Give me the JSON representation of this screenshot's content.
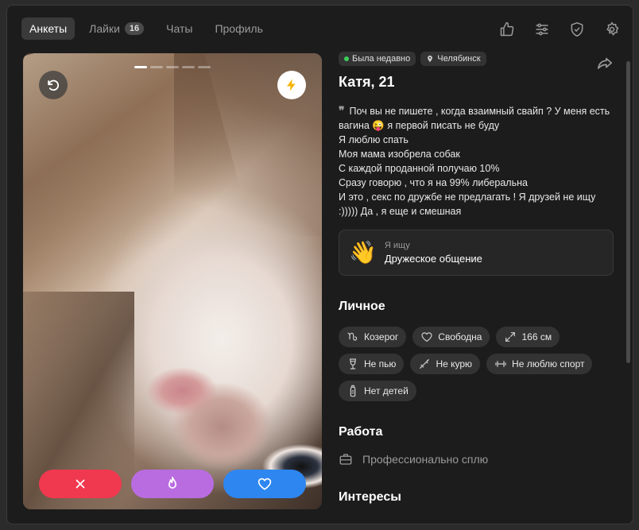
{
  "tabs": [
    {
      "label": "Анкеты",
      "active": true
    },
    {
      "label": "Лайки",
      "badge": "16"
    },
    {
      "label": "Чаты"
    },
    {
      "label": "Профиль"
    }
  ],
  "top_icons": [
    "thumbs-up-icon",
    "filters-icon",
    "shield-icon",
    "settings-icon"
  ],
  "photo": {
    "indicator_count": 5,
    "active_index": 0
  },
  "actions": {
    "colors": {
      "dislike": "#f0384f",
      "super": "#b96ce0",
      "like": "#2e86f0"
    }
  },
  "profile": {
    "status": "Была недавно",
    "city": "Челябинск",
    "name": "Катя, 21",
    "bio": "Поч вы не пишете , когда взаимный свайп ? У меня есть вагина 😜 я первой писать не буду\nЯ люблю спать\nМоя мама изобрела собак\nС каждой проданной получаю 10%\nСразу говорю , что я на 99% либеральна\nИ это , секс по дружбе не предлагать ! Я друзей не ищу :))))) Да , я еще и смешная",
    "seeking_label": "Я ищу",
    "seeking_value": "Дружеское общение"
  },
  "personal": {
    "title": "Личное",
    "zodiac": "Козерог",
    "relationship": "Свободна",
    "height": "166 см",
    "drinking": "Не пью",
    "smoking": "Не курю",
    "sport": "Не люблю спорт",
    "kids": "Нет детей"
  },
  "work": {
    "title": "Работа",
    "value": "Профессионально сплю"
  },
  "interests": {
    "title": "Интересы"
  }
}
